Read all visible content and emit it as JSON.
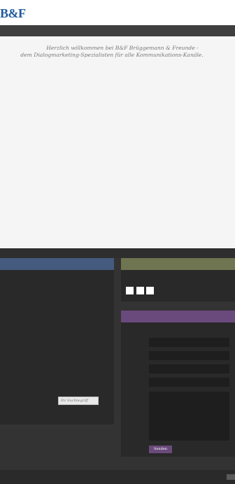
{
  "header": {
    "logo_text": "B&F"
  },
  "main": {
    "welcome_line1": "Herzlich willkommen bei B&F Brüggemann & Freunde -",
    "welcome_line2": "dem Dialogmarketing-Spezialisten für alle Kommunikations-Kanäle."
  },
  "search": {
    "placeholder": "Ihr Suchbegriff"
  },
  "contact": {
    "send_label": "Senden"
  },
  "colors": {
    "brand_blue": "#1f5a9c",
    "panel_blue": "#455a7f",
    "panel_olive": "#6f7551",
    "panel_purple": "#6a4a7c"
  },
  "icons": [
    "social-icon-1",
    "social-icon-2",
    "social-icon-3"
  ]
}
